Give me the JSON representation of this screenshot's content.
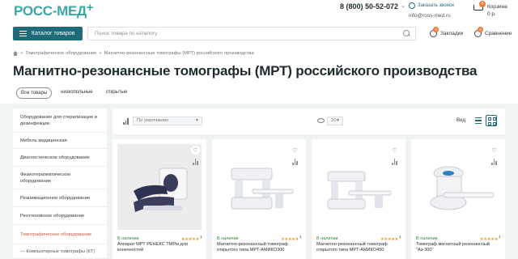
{
  "header": {
    "logo_main": "РОСС",
    "logo_dash": "-",
    "logo_tail": "МЕД",
    "logo_plus": "+",
    "phone": "8 (800) 50-52-072",
    "phone_arrow": "⌄",
    "callback_label": "Заказать звонок",
    "email": "info@ross-med.ru",
    "cart_label": "Корзина",
    "cart_sum": "0 р.",
    "cart_count": "0",
    "catalog_button": "Каталог товаров",
    "search_placeholder": "Поиск товара по каталогу",
    "bookmarks_label": "Закладки",
    "bookmarks_count": "0",
    "compare_label": "Сравнение",
    "compare_count": "0"
  },
  "breadcrumb": {
    "sep1": "»",
    "item1": "Томографическое оборудование",
    "sep2": "»",
    "item2": "Магнитно-резонансные томографы (МРТ) российского производства"
  },
  "page_title": "Магнитно-резонансные томографы (МРТ) российского производства",
  "filters": [
    "Все товары",
    "низкопольные",
    "открытые"
  ],
  "sidebar": {
    "items": [
      "Оборудование для стерилизации и дезинфекции",
      "Мебель медицинская",
      "Диагностическое оборудование",
      "Физиотерапевтическое оборудование",
      "Реанимационное оборудование",
      "Рентгеновское оборудование",
      "Томографическое оборудование",
      "— Компьютерные томографы (КТ)"
    ]
  },
  "toolbar": {
    "sort_value": "По умолчанию",
    "per_page_value": "20",
    "view_label": "Вид:"
  },
  "colors": {
    "brand": "#3aa6a8",
    "primary_button": "#1f6b79",
    "badge": "#f07b3a",
    "in_stock": "#2e8b3a",
    "active_category": "#c85a3a",
    "stars": "#f2a22a"
  },
  "products": [
    {
      "stock": "В наличии",
      "stars": "★★★★★",
      "rating_count": "1",
      "name": "Аппарат МРТ РЕНЕКС ТМРм для конечностей"
    },
    {
      "stock": "В наличии",
      "stars": "★★★★★",
      "rating_count": "1",
      "name": "Магнитно-резонансный томограф открытого типа МРТ-АМИКО300"
    },
    {
      "stock": "В наличии",
      "stars": "★★★★★",
      "rating_count": "1",
      "name": "Магнитно-резонансный томограф открытого типа МРТ-АМИКО450"
    },
    {
      "stock": "В наличии",
      "stars": "★★★★★",
      "rating_count": "1",
      "name": "Томограф магнитный резонансный \"Аз-300\""
    }
  ],
  "icons": {
    "favorite": "♡",
    "compare": "bar-chart-icon"
  }
}
